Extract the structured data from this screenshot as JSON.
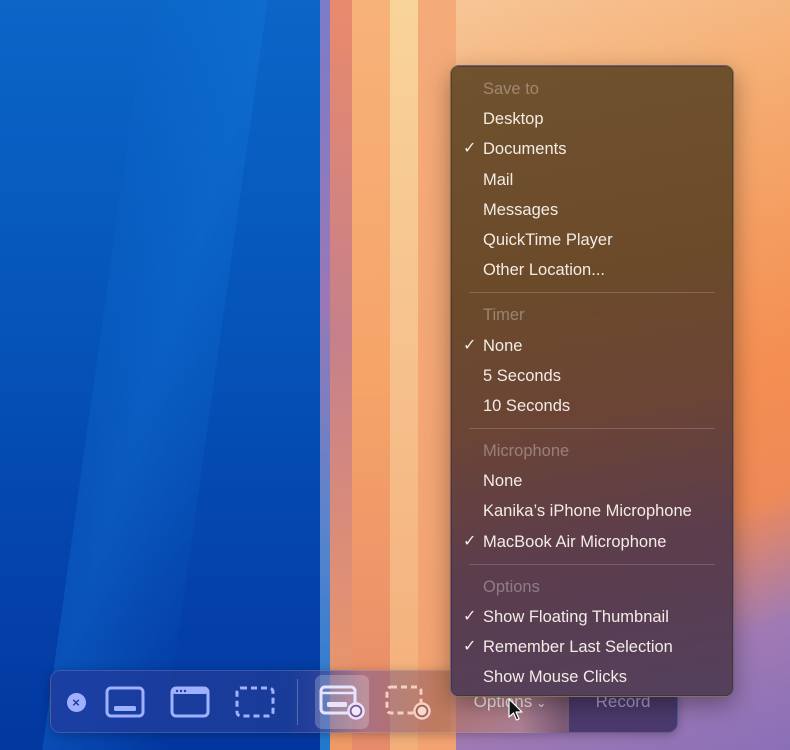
{
  "menu": {
    "sections": [
      {
        "title": "Save to",
        "items": [
          {
            "label": "Desktop",
            "checked": false
          },
          {
            "label": "Documents",
            "checked": true
          },
          {
            "label": "Mail",
            "checked": false
          },
          {
            "label": "Messages",
            "checked": false
          },
          {
            "label": "QuickTime Player",
            "checked": false
          },
          {
            "label": "Other Location...",
            "checked": false
          }
        ]
      },
      {
        "title": "Timer",
        "items": [
          {
            "label": "None",
            "checked": true
          },
          {
            "label": "5 Seconds",
            "checked": false
          },
          {
            "label": "10 Seconds",
            "checked": false
          }
        ]
      },
      {
        "title": "Microphone",
        "items": [
          {
            "label": "None",
            "checked": false
          },
          {
            "label": "Kanika’s iPhone Microphone",
            "checked": false
          },
          {
            "label": "MacBook Air Microphone",
            "checked": true
          }
        ]
      },
      {
        "title": "Options",
        "items": [
          {
            "label": "Show Floating Thumbnail",
            "checked": true
          },
          {
            "label": "Remember Last Selection",
            "checked": true
          },
          {
            "label": "Show Mouse Clicks",
            "checked": false
          }
        ]
      }
    ],
    "check_glyph": "✓"
  },
  "toolbar": {
    "close_glyph": "×",
    "tools": [
      {
        "name": "capture-entire-screen",
        "icon": "screen-capture-icon",
        "selected": false
      },
      {
        "name": "capture-selected-window",
        "icon": "window-capture-icon",
        "selected": false
      },
      {
        "name": "capture-selected-portion",
        "icon": "selection-capture-icon",
        "selected": false
      },
      {
        "name": "record-entire-screen",
        "icon": "screen-record-icon",
        "selected": true
      },
      {
        "name": "record-selected-portion",
        "icon": "selection-record-icon",
        "selected": false
      }
    ],
    "options_label": "Options",
    "options_chevron": "⌄",
    "record_label": "Record"
  },
  "colors": {
    "toolbar_icon": "#9fb0ff",
    "selected_icon": "#e8e4ff",
    "portion_record_icon": "#f5cfc4",
    "menu_text": "#f3ece6"
  }
}
